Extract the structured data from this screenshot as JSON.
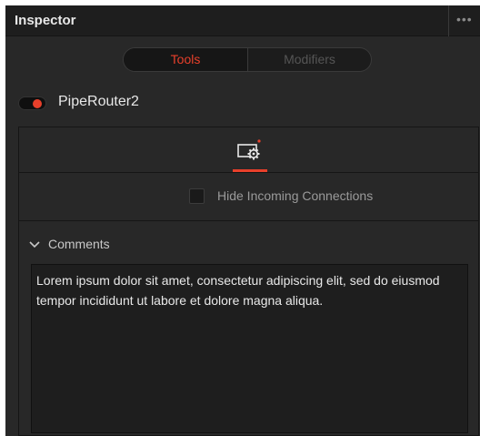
{
  "header": {
    "title": "Inspector",
    "menu_glyph": "•••",
    "menu_icon": "more-options-icon"
  },
  "tabs": {
    "tools_label": "Tools",
    "modifiers_label": "Modifiers",
    "active": "Tools"
  },
  "node": {
    "name": "PipeRouter2",
    "enabled": true
  },
  "controls": {
    "settings_icon": "settings-tab-icon",
    "hide_incoming_label": "Hide Incoming Connections",
    "hide_incoming_checked": false
  },
  "comments": {
    "header_label": "Comments",
    "text": "Lorem ipsum dolor sit amet, consectetur adipiscing elit, sed do eiusmod tempor incididunt ut labore et dolore magna aliqua."
  },
  "colors": {
    "accent": "#e8402b",
    "background": "#282828",
    "header_background": "#1e1e1e"
  }
}
